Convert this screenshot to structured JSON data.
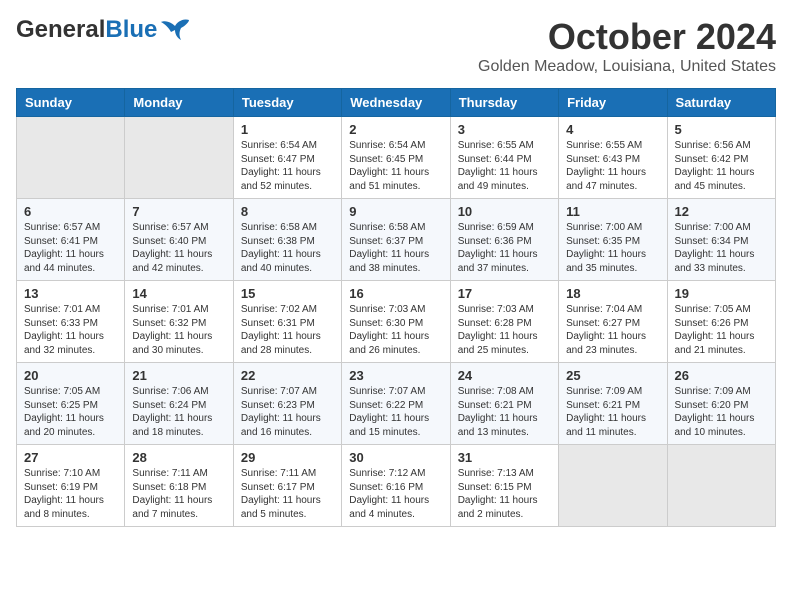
{
  "header": {
    "logo_general": "General",
    "logo_blue": "Blue",
    "month_year": "October 2024",
    "location": "Golden Meadow, Louisiana, United States"
  },
  "weekdays": [
    "Sunday",
    "Monday",
    "Tuesday",
    "Wednesday",
    "Thursday",
    "Friday",
    "Saturday"
  ],
  "weeks": [
    [
      {
        "day": "",
        "empty": true
      },
      {
        "day": "",
        "empty": true
      },
      {
        "day": "1",
        "sunrise": "6:54 AM",
        "sunset": "6:47 PM",
        "daylight": "11 hours and 52 minutes."
      },
      {
        "day": "2",
        "sunrise": "6:54 AM",
        "sunset": "6:45 PM",
        "daylight": "11 hours and 51 minutes."
      },
      {
        "day": "3",
        "sunrise": "6:55 AM",
        "sunset": "6:44 PM",
        "daylight": "11 hours and 49 minutes."
      },
      {
        "day": "4",
        "sunrise": "6:55 AM",
        "sunset": "6:43 PM",
        "daylight": "11 hours and 47 minutes."
      },
      {
        "day": "5",
        "sunrise": "6:56 AM",
        "sunset": "6:42 PM",
        "daylight": "11 hours and 45 minutes."
      }
    ],
    [
      {
        "day": "6",
        "sunrise": "6:57 AM",
        "sunset": "6:41 PM",
        "daylight": "11 hours and 44 minutes."
      },
      {
        "day": "7",
        "sunrise": "6:57 AM",
        "sunset": "6:40 PM",
        "daylight": "11 hours and 42 minutes."
      },
      {
        "day": "8",
        "sunrise": "6:58 AM",
        "sunset": "6:38 PM",
        "daylight": "11 hours and 40 minutes."
      },
      {
        "day": "9",
        "sunrise": "6:58 AM",
        "sunset": "6:37 PM",
        "daylight": "11 hours and 38 minutes."
      },
      {
        "day": "10",
        "sunrise": "6:59 AM",
        "sunset": "6:36 PM",
        "daylight": "11 hours and 37 minutes."
      },
      {
        "day": "11",
        "sunrise": "7:00 AM",
        "sunset": "6:35 PM",
        "daylight": "11 hours and 35 minutes."
      },
      {
        "day": "12",
        "sunrise": "7:00 AM",
        "sunset": "6:34 PM",
        "daylight": "11 hours and 33 minutes."
      }
    ],
    [
      {
        "day": "13",
        "sunrise": "7:01 AM",
        "sunset": "6:33 PM",
        "daylight": "11 hours and 32 minutes."
      },
      {
        "day": "14",
        "sunrise": "7:01 AM",
        "sunset": "6:32 PM",
        "daylight": "11 hours and 30 minutes."
      },
      {
        "day": "15",
        "sunrise": "7:02 AM",
        "sunset": "6:31 PM",
        "daylight": "11 hours and 28 minutes."
      },
      {
        "day": "16",
        "sunrise": "7:03 AM",
        "sunset": "6:30 PM",
        "daylight": "11 hours and 26 minutes."
      },
      {
        "day": "17",
        "sunrise": "7:03 AM",
        "sunset": "6:28 PM",
        "daylight": "11 hours and 25 minutes."
      },
      {
        "day": "18",
        "sunrise": "7:04 AM",
        "sunset": "6:27 PM",
        "daylight": "11 hours and 23 minutes."
      },
      {
        "day": "19",
        "sunrise": "7:05 AM",
        "sunset": "6:26 PM",
        "daylight": "11 hours and 21 minutes."
      }
    ],
    [
      {
        "day": "20",
        "sunrise": "7:05 AM",
        "sunset": "6:25 PM",
        "daylight": "11 hours and 20 minutes."
      },
      {
        "day": "21",
        "sunrise": "7:06 AM",
        "sunset": "6:24 PM",
        "daylight": "11 hours and 18 minutes."
      },
      {
        "day": "22",
        "sunrise": "7:07 AM",
        "sunset": "6:23 PM",
        "daylight": "11 hours and 16 minutes."
      },
      {
        "day": "23",
        "sunrise": "7:07 AM",
        "sunset": "6:22 PM",
        "daylight": "11 hours and 15 minutes."
      },
      {
        "day": "24",
        "sunrise": "7:08 AM",
        "sunset": "6:21 PM",
        "daylight": "11 hours and 13 minutes."
      },
      {
        "day": "25",
        "sunrise": "7:09 AM",
        "sunset": "6:21 PM",
        "daylight": "11 hours and 11 minutes."
      },
      {
        "day": "26",
        "sunrise": "7:09 AM",
        "sunset": "6:20 PM",
        "daylight": "11 hours and 10 minutes."
      }
    ],
    [
      {
        "day": "27",
        "sunrise": "7:10 AM",
        "sunset": "6:19 PM",
        "daylight": "11 hours and 8 minutes."
      },
      {
        "day": "28",
        "sunrise": "7:11 AM",
        "sunset": "6:18 PM",
        "daylight": "11 hours and 7 minutes."
      },
      {
        "day": "29",
        "sunrise": "7:11 AM",
        "sunset": "6:17 PM",
        "daylight": "11 hours and 5 minutes."
      },
      {
        "day": "30",
        "sunrise": "7:12 AM",
        "sunset": "6:16 PM",
        "daylight": "11 hours and 4 minutes."
      },
      {
        "day": "31",
        "sunrise": "7:13 AM",
        "sunset": "6:15 PM",
        "daylight": "11 hours and 2 minutes."
      },
      {
        "day": "",
        "empty": true
      },
      {
        "day": "",
        "empty": true
      }
    ]
  ],
  "labels": {
    "sunrise": "Sunrise:",
    "sunset": "Sunset:",
    "daylight": "Daylight:"
  }
}
